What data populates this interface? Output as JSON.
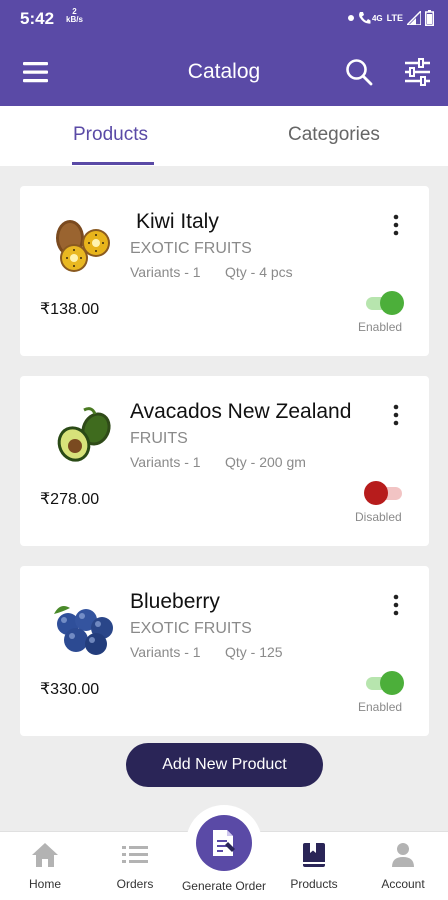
{
  "status_bar": {
    "time": "5:42",
    "net_speed_value": "2",
    "net_speed_unit": "kB/s",
    "network_label": "4G",
    "lte_label": "LTE"
  },
  "app_bar": {
    "title": "Catalog",
    "icons": {
      "menu": "hamburger-menu-icon",
      "search": "search-icon",
      "filter": "filter-sliders-icon"
    }
  },
  "tabs": [
    {
      "label": "Products",
      "active": true
    },
    {
      "label": "Categories",
      "active": false
    }
  ],
  "products": [
    {
      "name": "Kiwi Italy",
      "category": "EXOTIC FRUITS",
      "variants": "Variants - 1",
      "qty": "Qty - 4 pcs",
      "price": "₹138.00",
      "enabled": true,
      "status_label": "Enabled",
      "image": "kiwi-image"
    },
    {
      "name": "Avacados New Zealand",
      "category": "FRUITS",
      "variants": "Variants - 1",
      "qty": "Qty - 200 gm",
      "price": "₹278.00",
      "enabled": false,
      "status_label": "Disabled",
      "image": "avocado-image"
    },
    {
      "name": "Blueberry",
      "category": "EXOTIC FRUITS",
      "variants": "Variants - 1",
      "qty": "Qty - 125",
      "price": "₹330.00",
      "enabled": true,
      "status_label": "Enabled",
      "image": "blueberry-image"
    }
  ],
  "add_button_label": "Add New Product",
  "bottom_nav": [
    {
      "label": "Home",
      "icon": "home-icon"
    },
    {
      "label": "Orders",
      "icon": "orders-list-icon"
    },
    {
      "label": "Generate Order",
      "icon": "generate-order-icon"
    },
    {
      "label": "Products",
      "icon": "products-bookmark-icon"
    },
    {
      "label": "Account",
      "icon": "account-person-icon"
    }
  ],
  "colors": {
    "primary": "#5a4aa6",
    "dark_button": "#2a2557",
    "toggle_on": "#4caf3a",
    "toggle_off": "#b71c1c",
    "background": "#ededed"
  }
}
